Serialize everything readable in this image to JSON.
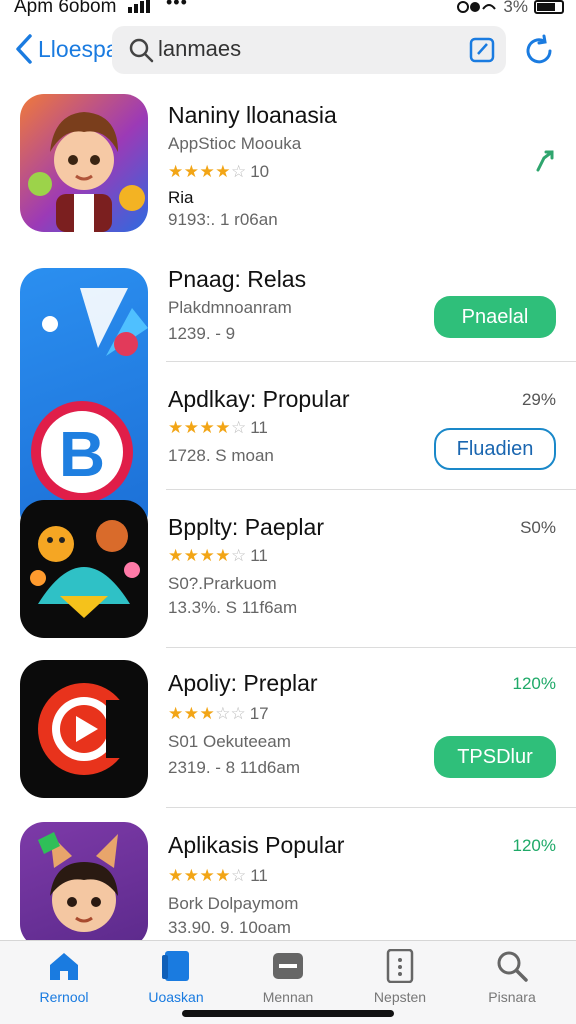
{
  "status": {
    "time": "Apm 6obom",
    "dots": "•••",
    "battery_pct": "3%"
  },
  "nav": {
    "back_label": "Lloespa",
    "search_text": "lanmaes"
  },
  "apps": [
    {
      "title": "Naniny lloanasia",
      "subtitle": "AppStioc Moouka",
      "rating": "10",
      "extra": "Ria",
      "meta": "9193:. 1 r06an",
      "action": "share"
    },
    {
      "title": "Pnaag: Relas",
      "subtitle": "Plakdmnoanram",
      "meta": "1239. - 9",
      "button": "Pnaelal",
      "button_style": "fill"
    },
    {
      "title": "Apdlkay: Propular",
      "rating": "11",
      "meta": "1728. S moan",
      "pct": "29%",
      "button": "Fluadien",
      "button_style": "outline"
    },
    {
      "title": "Bpplty: Paeplar",
      "rating": "11",
      "subtitle": "S0?.Prarkuom",
      "meta": "13.3%. S 11f6am",
      "pct": "S0%"
    },
    {
      "title": "Apoliy: Preplar",
      "rating": "17",
      "subtitle": "S01 Oekuteeam",
      "meta": "2319. - 8 11d6am",
      "pct": "120%",
      "pct_color": "green",
      "button": "TPSDlur",
      "button_style": "fill"
    },
    {
      "title": "Aplikasis Popular",
      "rating": "11",
      "subtitle": "Bork Dolpaymom",
      "meta": "33.90. 9. 10oam",
      "pct": "120%",
      "pct_color": "green"
    }
  ],
  "tabs": [
    {
      "label": "Rernool",
      "icon": "home-icon"
    },
    {
      "label": "Uoaskan",
      "icon": "apps-icon"
    },
    {
      "label": "Mennan",
      "icon": "games-icon"
    },
    {
      "label": "Nepsten",
      "icon": "updates-icon"
    },
    {
      "label": "Pisnara",
      "icon": "search-icon"
    }
  ],
  "colors": {
    "accent": "#1a7be0",
    "green": "#2fbf7a",
    "star": "#f2a516"
  }
}
